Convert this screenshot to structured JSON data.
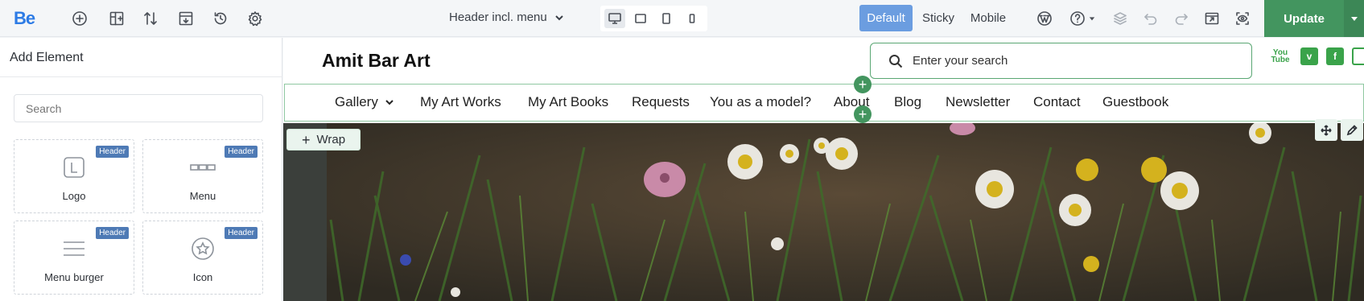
{
  "toolbar": {
    "logo": "Be",
    "template_select": "Header incl. menu",
    "modes": [
      "Default",
      "Sticky",
      "Mobile"
    ],
    "update_label": "Update",
    "icons": [
      "add-icon",
      "navigator-icon",
      "sort-icon",
      "template-icon",
      "history-icon",
      "settings-icon",
      "wordpress-icon",
      "help-icon",
      "layers-icon",
      "undo-icon",
      "redo-icon",
      "preview-icon",
      "eye-icon"
    ]
  },
  "sidebar": {
    "title": "Add Element",
    "search_placeholder": "Search",
    "elements": [
      {
        "label": "Logo",
        "badge": "Header",
        "icon": "logo-icon"
      },
      {
        "label": "Menu",
        "badge": "Header",
        "icon": "menu-icon"
      },
      {
        "label": "Menu burger",
        "badge": "Header",
        "icon": "burger-icon"
      },
      {
        "label": "Icon",
        "badge": "Header",
        "icon": "star-icon"
      }
    ]
  },
  "site": {
    "title": "Amit Bar Art",
    "search_placeholder": "Enter your search",
    "social": [
      "You Tube",
      "v",
      "f"
    ],
    "menu": [
      "Gallery",
      "My Art Works",
      "My Art Books",
      "Requests",
      "You as a model?",
      "About",
      "Blog",
      "Newsletter",
      "Contact",
      "Guestbook"
    ],
    "wrap_label": "Wrap"
  },
  "colors": {
    "accent_blue": "#6b9de0",
    "update_green": "#43955f",
    "brand_blue": "#2d7be5",
    "social_green": "#3aa34a"
  }
}
